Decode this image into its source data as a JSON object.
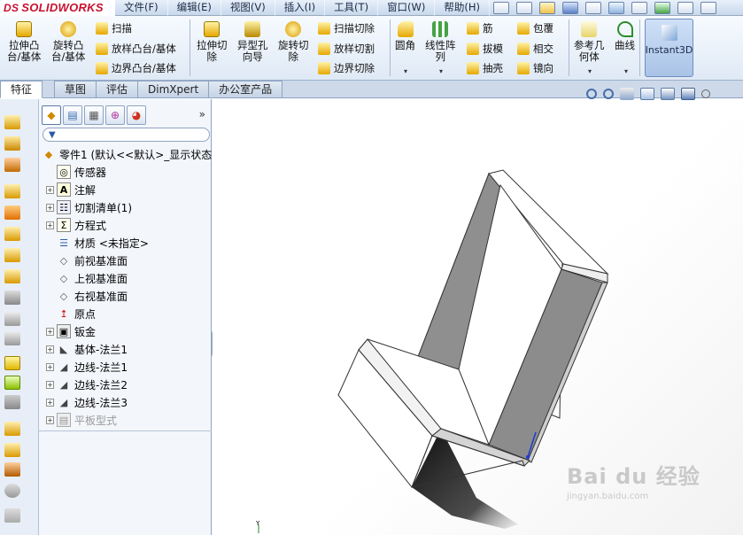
{
  "app": {
    "logo_text": "SOLIDWORKS",
    "logo_prefix": "DS"
  },
  "menu": [
    "文件(F)",
    "编辑(E)",
    "视图(V)",
    "插入(I)",
    "工具(T)",
    "窗口(W)",
    "帮助(H)"
  ],
  "commands": {
    "extrude_boss": "拉伸凸\n台/基体",
    "revolve_boss": "旋转凸\n台/基体",
    "sweep": "扫描",
    "loft_boss": "放样凸台/基体",
    "boundary_boss": "边界凸台/基体",
    "extrude_cut": "拉伸切\n除",
    "hole_wizard": "异型孔\n向导",
    "revolve_cut": "旋转切\n除",
    "sweep_cut": "扫描切除",
    "loft_cut": "放样切割",
    "boundary_cut": "边界切除",
    "fillet": "圆角",
    "linear_pattern": "线性阵\n列",
    "rib": "筋",
    "draft": "拔模",
    "shell": "抽壳",
    "wrap": "包覆",
    "intersect": "相交",
    "mirror": "镜向",
    "ref_geometry": "参考几\n何体",
    "curves": "曲线",
    "instant3d": "Instant3D"
  },
  "tabs": [
    "特征",
    "草图",
    "评估",
    "DimXpert",
    "办公室产品"
  ],
  "feature_tree": {
    "root": "零件1 (默认<<默认>_显示状态",
    "items": [
      {
        "label": "传感器",
        "expandable": false,
        "icon": "sensor-icon"
      },
      {
        "label": "注解",
        "expandable": true,
        "icon": "annotation-icon"
      },
      {
        "label": "切割清单(1)",
        "expandable": true,
        "icon": "cut-list-icon"
      },
      {
        "label": "方程式",
        "expandable": true,
        "icon": "equation-icon"
      },
      {
        "label": "材质 <未指定>",
        "expandable": false,
        "icon": "material-icon"
      },
      {
        "label": "前视基准面",
        "expandable": false,
        "icon": "plane-icon"
      },
      {
        "label": "上视基准面",
        "expandable": false,
        "icon": "plane-icon"
      },
      {
        "label": "右视基准面",
        "expandable": false,
        "icon": "plane-icon"
      },
      {
        "label": "原点",
        "expandable": false,
        "icon": "origin-icon"
      },
      {
        "label": "钣金",
        "expandable": true,
        "icon": "sheet-metal-icon"
      },
      {
        "label": "基体-法兰1",
        "expandable": true,
        "icon": "base-flange-icon"
      },
      {
        "label": "边线-法兰1",
        "expandable": true,
        "icon": "edge-flange-icon"
      },
      {
        "label": "边线-法兰2",
        "expandable": true,
        "icon": "edge-flange-icon"
      },
      {
        "label": "边线-法兰3",
        "expandable": true,
        "icon": "edge-flange-icon"
      },
      {
        "label": "平板型式",
        "expandable": true,
        "icon": "flat-pattern-icon",
        "dim": true
      }
    ]
  },
  "viewport": {
    "axis_label": "Y"
  },
  "watermark": {
    "main": "Bai du 经验",
    "sub": "jingyan.baidu.com"
  }
}
